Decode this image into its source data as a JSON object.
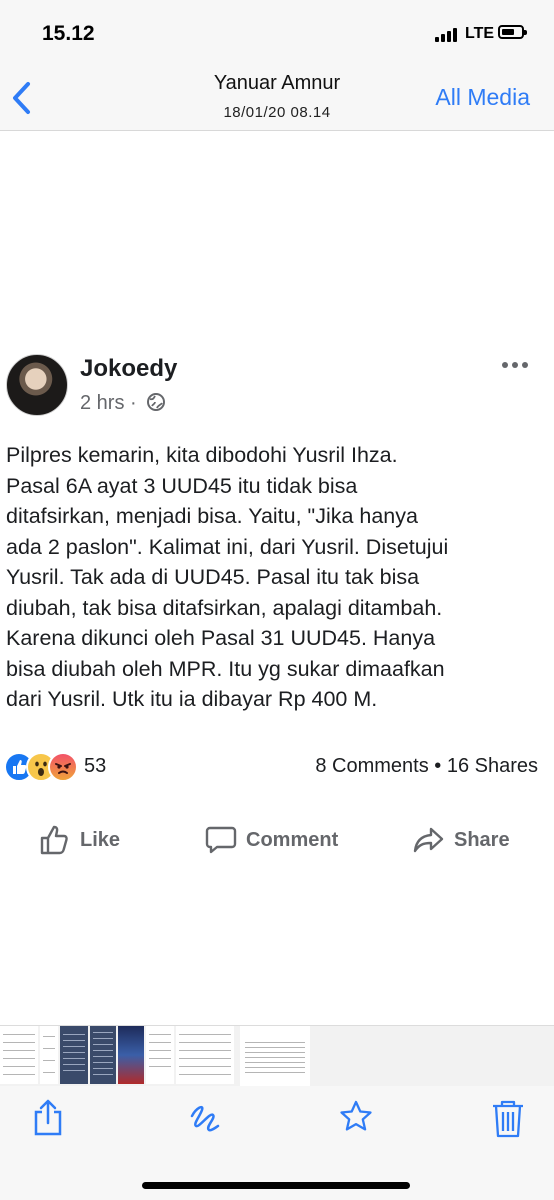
{
  "status_bar": {
    "time": "15.12",
    "network": "LTE"
  },
  "nav": {
    "title": "Yanuar Amnur",
    "subtitle": "18/01/20 08.14",
    "right_action": "All Media",
    "back_icon": "chevron-left-icon"
  },
  "post": {
    "author": "Jokoedy",
    "time_ago": "2 hrs",
    "separator": "·",
    "privacy_icon": "globe-icon",
    "lines": [
      "Pilpres kemarin, kita dibodohi Yusril Ihza.",
      "Pasal 6A ayat 3 UUD45  itu tidak bisa",
      "ditafsirkan,  menjadi bisa.  Yaitu,  \"Jika hanya",
      "ada 2 paslon\". Kalimat ini,  dari Yusril.  Disetujui",
      "Yusril.  Tak ada di UUD45. Pasal itu tak bisa",
      "diubah,  tak bisa ditafsirkan,   apalagi ditambah.",
      "Karena dikunci oleh Pasal 31 UUD45. Hanya",
      "bisa diubah oleh MPR.  Itu yg sukar dimaafkan",
      "dari Yusril.  Utk itu ia dibayar Rp 400 M."
    ],
    "reactions": {
      "icons": [
        "like",
        "wow",
        "angry"
      ],
      "count": "53"
    },
    "engagement": "8 Comments • 16 Shares",
    "actions": {
      "like": "Like",
      "comment": "Comment",
      "share": "Share"
    }
  },
  "toolbar": {
    "icons": [
      "share-icon",
      "markup-icon",
      "favorite-star-icon",
      "trash-icon"
    ]
  },
  "colors": {
    "accent": "#2f7cf6",
    "fb_blue": "#1877f2",
    "muted": "#65676b"
  }
}
